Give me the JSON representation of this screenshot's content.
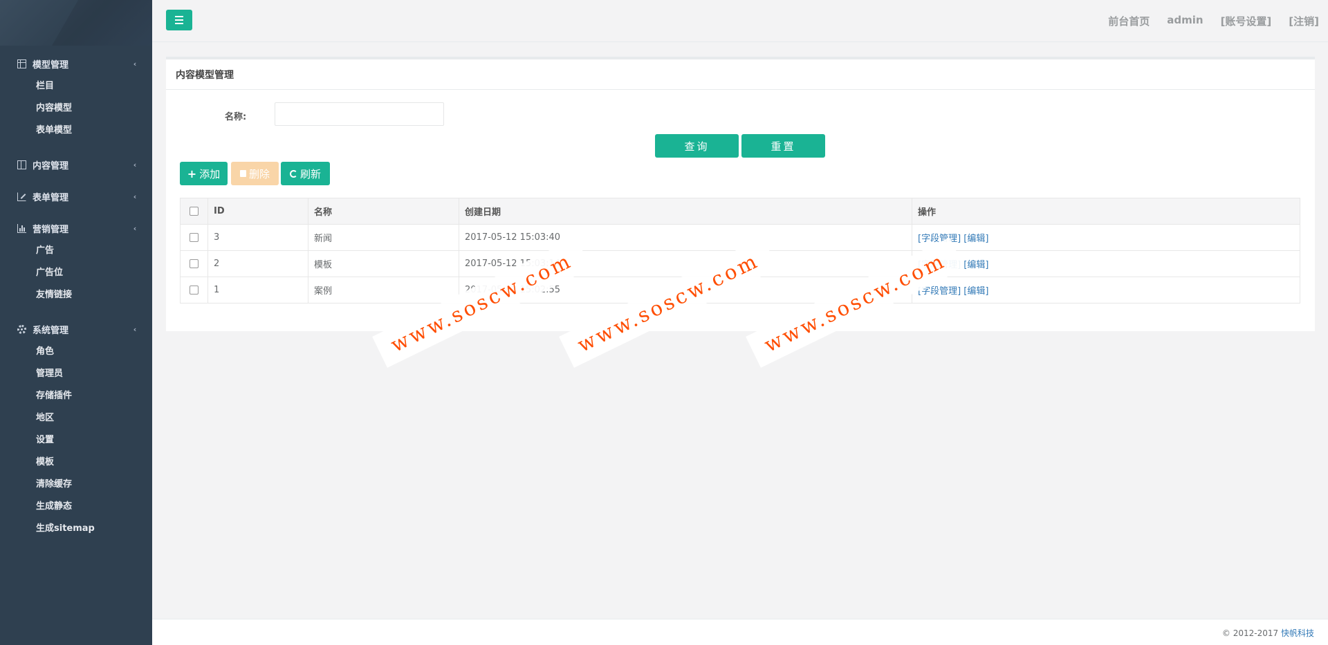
{
  "sidebar": {
    "groups": [
      {
        "label": "模型管理",
        "icon": "table-icon",
        "items": [
          "栏目",
          "内容模型",
          "表单模型"
        ]
      },
      {
        "label": "内容管理",
        "icon": "columns-icon",
        "items": []
      },
      {
        "label": "表单管理",
        "icon": "edit-icon",
        "items": []
      },
      {
        "label": "营销管理",
        "icon": "bar-chart-icon",
        "items": [
          "广告",
          "广告位",
          "友情链接"
        ]
      },
      {
        "label": "系统管理",
        "icon": "gear-icon",
        "items": [
          "角色",
          "管理员",
          "存储插件",
          "地区",
          "设置",
          "模板",
          "清除缓存",
          "生成静态",
          "生成sitemap"
        ]
      }
    ],
    "chevron": "‹"
  },
  "topbar": {
    "links": [
      "前台首页",
      "admin",
      "[账号设置]",
      "[注销]"
    ]
  },
  "panel": {
    "title": "内容模型管理",
    "search": {
      "label": "名称:",
      "value": "",
      "placeholder": ""
    },
    "buttons": {
      "query": "查询",
      "reset": "重置",
      "add": "添加",
      "delete": "删除",
      "refresh": "刷新"
    },
    "table": {
      "headers": [
        "ID",
        "名称",
        "创建日期",
        "操作"
      ],
      "rows": [
        {
          "id": "3",
          "name": "新闻",
          "created": "2017-05-12 15:03:40",
          "ops": [
            "[字段管理]",
            "[编辑]"
          ]
        },
        {
          "id": "2",
          "name": "模板",
          "created": "2017-05-12 15:03:14",
          "ops": [
            "[字段管理]",
            "[编辑]"
          ]
        },
        {
          "id": "1",
          "name": "案例",
          "created": "2017-05-12 15:02:55",
          "ops": [
            "[字段管理]",
            "[编辑]"
          ]
        }
      ]
    }
  },
  "watermark": "www.soscw.com",
  "footer": {
    "copyright": "© 2012-2017",
    "company": "快帆科技"
  },
  "colors": {
    "primary": "#1ab394",
    "sidebar": "#2f4050",
    "delete": "#f9d5a8",
    "link": "#337ab7",
    "watermark": "#ff4d00"
  }
}
